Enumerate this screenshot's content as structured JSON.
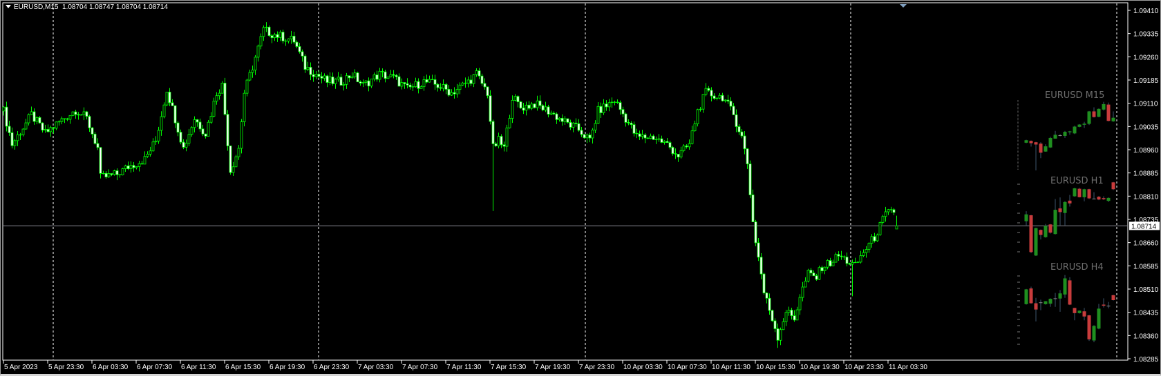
{
  "header": {
    "symbol": "EURUSD,M15",
    "ohlc": "1.08704 1.08747 1.08704 1.08714"
  },
  "colors": {
    "background": "#000000",
    "candle_outline": "#00ff00",
    "bull_fill": "#000000",
    "bear_fill": "#ffffff",
    "grid_separator": "#ffffff",
    "bid_line": "#8c8c96",
    "axis_text": "#ffffff",
    "mini_bull": "#1f8f1f",
    "mini_bear": "#c83c3c",
    "mini_doji": "#8a8a8a",
    "mini_wick": "#34485c",
    "mini_label": "#6e6e6e"
  },
  "chart_data": {
    "type": "candlestick",
    "symbol": "EURUSD",
    "timeframe": "M15",
    "ylim": [
      1.08285,
      1.0941
    ],
    "price_ticks": [
      "1.09410",
      "1.09335",
      "1.09260",
      "1.09185",
      "1.09110",
      "1.09035",
      "1.08960",
      "1.08885",
      "1.08810",
      "1.08735",
      "1.08660",
      "1.08585",
      "1.08510",
      "1.08435",
      "1.08360",
      "1.08285"
    ],
    "current_price": "1.08714",
    "time_labels": [
      {
        "bar": 0,
        "text": "5 Apr 2023"
      },
      {
        "bar": 16,
        "text": "5 Apr 23:30"
      },
      {
        "bar": 32,
        "text": "6 Apr 03:30"
      },
      {
        "bar": 48,
        "text": "6 Apr 07:30"
      },
      {
        "bar": 64,
        "text": "6 Apr 11:30"
      },
      {
        "bar": 80,
        "text": "6 Apr 15:30"
      },
      {
        "bar": 96,
        "text": "6 Apr 19:30"
      },
      {
        "bar": 112,
        "text": "6 Apr 23:30"
      },
      {
        "bar": 128,
        "text": "7 Apr 03:30"
      },
      {
        "bar": 144,
        "text": "7 Apr 07:30"
      },
      {
        "bar": 160,
        "text": "7 Apr 11:30"
      },
      {
        "bar": 176,
        "text": "7 Apr 15:30"
      },
      {
        "bar": 192,
        "text": "7 Apr 19:30"
      },
      {
        "bar": 208,
        "text": "7 Apr 23:30"
      },
      {
        "bar": 224,
        "text": "10 Apr 03:30"
      },
      {
        "bar": 240,
        "text": "10 Apr 07:30"
      },
      {
        "bar": 256,
        "text": "10 Apr 11:30"
      },
      {
        "bar": 272,
        "text": "10 Apr 15:30"
      },
      {
        "bar": 288,
        "text": "10 Apr 19:30"
      },
      {
        "bar": 304,
        "text": "10 Apr 23:30"
      },
      {
        "bar": 320,
        "text": "11 Apr 03:30"
      }
    ],
    "day_separators": [
      18,
      114,
      210.5,
      306.5,
      402.75
    ],
    "close_path": [
      [
        0,
        1.09085
      ],
      [
        3,
        1.08977
      ],
      [
        10,
        1.09073
      ],
      [
        15,
        1.09013
      ],
      [
        20,
        1.09049
      ],
      [
        26,
        1.09089
      ],
      [
        30,
        1.09061
      ],
      [
        34,
        1.08965
      ],
      [
        35,
        1.08869
      ],
      [
        41,
        1.08881
      ],
      [
        45,
        1.08905
      ],
      [
        51,
        1.08929
      ],
      [
        55,
        1.08989
      ],
      [
        59,
        1.09156
      ],
      [
        62,
        1.09061
      ],
      [
        65,
        1.08965
      ],
      [
        69,
        1.09061
      ],
      [
        73,
        1.09013
      ],
      [
        77,
        1.09144
      ],
      [
        79,
        1.09168
      ],
      [
        82,
        1.08893
      ],
      [
        85,
        1.08965
      ],
      [
        87,
        1.09144
      ],
      [
        90,
        1.09228
      ],
      [
        94,
        1.09347
      ],
      [
        97,
        1.09335
      ],
      [
        101,
        1.09324
      ],
      [
        105,
        1.09312
      ],
      [
        109,
        1.09228
      ],
      [
        113,
        1.09204
      ],
      [
        117,
        1.0918
      ],
      [
        122,
        1.0918
      ],
      [
        126,
        1.09204
      ],
      [
        130,
        1.09168
      ],
      [
        136,
        1.09204
      ],
      [
        141,
        1.09192
      ],
      [
        146,
        1.09156
      ],
      [
        152,
        1.0918
      ],
      [
        157,
        1.09168
      ],
      [
        162,
        1.09144
      ],
      [
        168,
        1.0918
      ],
      [
        171,
        1.09204
      ],
      [
        175,
        1.09144
      ],
      [
        177,
        1.08965
      ],
      [
        179,
        1.08989
      ],
      [
        181,
        1.08965
      ],
      [
        184,
        1.09132
      ],
      [
        187,
        1.09096
      ],
      [
        192,
        1.09108
      ],
      [
        197,
        1.09085
      ],
      [
        203,
        1.09049
      ],
      [
        208,
        1.09025
      ],
      [
        212,
        1.08989
      ],
      [
        215,
        1.09085
      ],
      [
        221,
        1.0912
      ],
      [
        225,
        1.09061
      ],
      [
        229,
        1.09001
      ],
      [
        235,
        1.09001
      ],
      [
        240,
        1.08977
      ],
      [
        244,
        1.08941
      ],
      [
        248,
        1.08977
      ],
      [
        251,
        1.09085
      ],
      [
        254,
        1.09144
      ],
      [
        258,
        1.09132
      ],
      [
        260,
        1.09132
      ],
      [
        264,
        1.09073
      ],
      [
        267,
        1.09001
      ],
      [
        269,
        1.08917
      ],
      [
        271,
        1.08726
      ],
      [
        272,
        1.08666
      ],
      [
        274,
        1.08559
      ],
      [
        275,
        1.08499
      ],
      [
        278,
        1.08415
      ],
      [
        280,
        1.08356
      ],
      [
        283,
        1.08439
      ],
      [
        286,
        1.08415
      ],
      [
        288,
        1.08487
      ],
      [
        291,
        1.08559
      ],
      [
        294,
        1.08547
      ],
      [
        296,
        1.08583
      ],
      [
        299,
        1.08595
      ],
      [
        302,
        1.08618
      ],
      [
        304,
        1.08607
      ],
      [
        308,
        1.08583
      ],
      [
        311,
        1.0863
      ],
      [
        315,
        1.08678
      ],
      [
        319,
        1.0875
      ],
      [
        322,
        1.08762
      ],
      [
        323,
        1.08714
      ]
    ],
    "spikes": [
      {
        "bar": 177,
        "low": 1.08762
      },
      {
        "bar": 307,
        "low": 1.08487
      },
      {
        "bar": 280,
        "low": 1.0832
      }
    ],
    "last_bar": {
      "open": 1.08704,
      "high": 1.08747,
      "low": 1.08704,
      "close": 1.08714
    }
  },
  "mini_charts": [
    {
      "title": "EURUSD M15",
      "range": [
        0,
        310
      ],
      "candles": [
        [
          122,
          135,
          120,
          133
        ],
        [
          130,
          132,
          105,
          120
        ],
        [
          124,
          126,
          0,
          114
        ],
        [
          118,
          124,
          54,
          78
        ],
        [
          83,
          115,
          82,
          106
        ],
        [
          101,
          148,
          99,
          143
        ],
        [
          140,
          174,
          140,
          157
        ],
        [
          155,
          160,
          150,
          155
        ],
        [
          152,
          174,
          143,
          170
        ],
        [
          168,
          174,
          157,
          172
        ],
        [
          163,
          197,
          160,
          193
        ],
        [
          192,
          204,
          190,
          202
        ],
        [
          201,
          214,
          187,
          206
        ],
        [
          205,
          262,
          200,
          260
        ],
        [
          260,
          278,
          233,
          235
        ],
        [
          236,
          273,
          234,
          271
        ],
        [
          268,
          302,
          264,
          292
        ],
        [
          290,
          299,
          216,
          218
        ],
        [
          216,
          260,
          214,
          232
        ]
      ]
    },
    {
      "title": "EURUSD H1",
      "range": [
        0,
        332
      ],
      "candles": [
        [
          158,
          202,
          140,
          188
        ],
        [
          184,
          186,
          18,
          23
        ],
        [
          8,
          130,
          6,
          128
        ],
        [
          120,
          122,
          78,
          98
        ],
        [
          88,
          146,
          86,
          138
        ],
        [
          144,
          146,
          104,
          108
        ],
        [
          102,
          255,
          100,
          208
        ],
        [
          214,
          262,
          140,
          198
        ],
        [
          194,
          246,
          140,
          242
        ],
        [
          248,
          273,
          222,
          236
        ],
        [
          267,
          304,
          265,
          302
        ],
        [
          300,
          304,
          262,
          263
        ],
        [
          263,
          300,
          245,
          298
        ],
        [
          298,
          300,
          255,
          258
        ],
        [
          257,
          285,
          255,
          257
        ],
        [
          265,
          268,
          250,
          253
        ],
        [
          259,
          267,
          251,
          254
        ],
        [
          247,
          262,
          242,
          260
        ],
        [
          328,
          330,
          294,
          298
        ]
      ]
    },
    {
      "title": "EURUSD H4",
      "range": [
        0,
        320
      ],
      "candles": [
        [
          182,
          250,
          180,
          248
        ],
        [
          252,
          260,
          184,
          186
        ],
        [
          186,
          210,
          105,
          158
        ],
        [
          190,
          202,
          155,
          190
        ],
        [
          182,
          196,
          180,
          195
        ],
        [
          184,
          208,
          170,
          206
        ],
        [
          208,
          232,
          170,
          208
        ],
        [
          207,
          245,
          148,
          230
        ],
        [
          225,
          312,
          210,
          297
        ],
        [
          288,
          302,
          178,
          180
        ],
        [
          165,
          166,
          110,
          142
        ],
        [
          142,
          154,
          140,
          153
        ],
        [
          150,
          165,
          110,
          127
        ],
        [
          132,
          134,
          18,
          25
        ],
        [
          20,
          88,
          12,
          85
        ],
        [
          73,
          183,
          70,
          162
        ],
        [
          180,
          208,
          167,
          175
        ],
        [
          175,
          192,
          163,
          175
        ],
        [
          222,
          224,
          198,
          200
        ]
      ]
    }
  ]
}
